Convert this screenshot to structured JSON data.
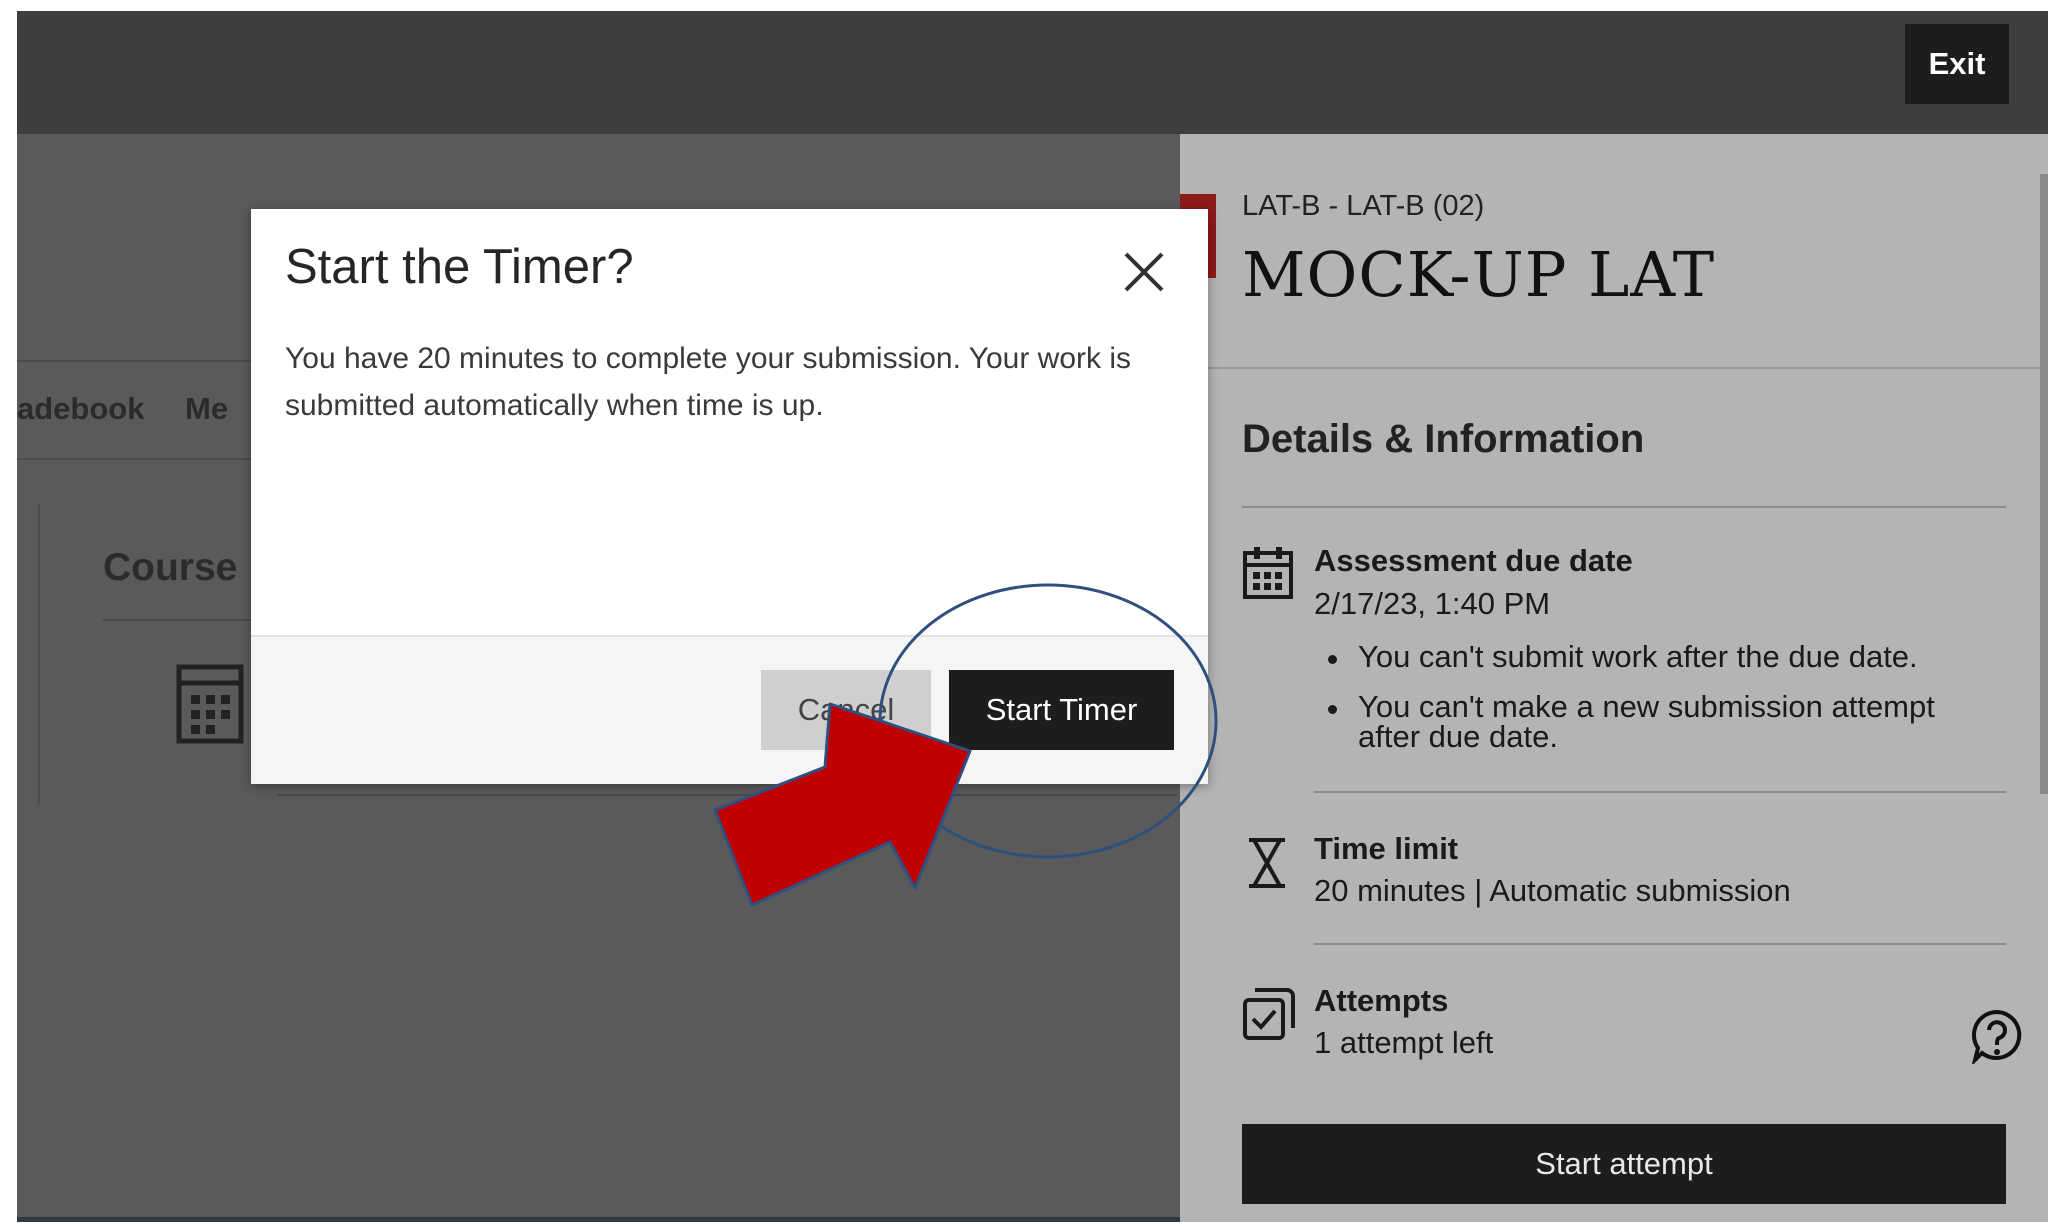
{
  "topbar": {
    "exit_label": "Exit"
  },
  "background": {
    "tab_gradebook": "adebook",
    "tab_messages": "Me",
    "course_heading": "Course"
  },
  "panel": {
    "course_code": "LAT-B - LAT-B (02)",
    "title": "MOCK-UP LAT",
    "details_heading": "Details & Information",
    "due": {
      "label": "Assessment due date",
      "value": "2/17/23, 1:40 PM",
      "notes": [
        "You can't submit work after the due date.",
        "You can't make a new submission attempt after due date."
      ]
    },
    "time_limit": {
      "label": "Time limit",
      "value": "20 minutes | Automatic submission"
    },
    "attempts": {
      "label": "Attempts",
      "value": "1 attempt left"
    },
    "start_attempt_label": "Start attempt",
    "icons": {
      "due": "calendar-icon",
      "time_limit": "hourglass-icon",
      "attempts": "checkbox-icon",
      "help": "help-icon"
    }
  },
  "modal": {
    "title": "Start the Timer?",
    "body": "You have 20 minutes to complete your submission. Your work is submitted automatically when time is up.",
    "cancel_label": "Cancel",
    "confirm_label": "Start Timer"
  },
  "colors": {
    "topbar": "#3f3f3f",
    "overlay": "#5a5a5a",
    "panel": "#b4b4b4",
    "button_dark": "#1d1d1d",
    "accent_red": "#8e1a1a",
    "annotation_arrow": "#c00000",
    "annotation_outline": "#2f4f7f"
  }
}
